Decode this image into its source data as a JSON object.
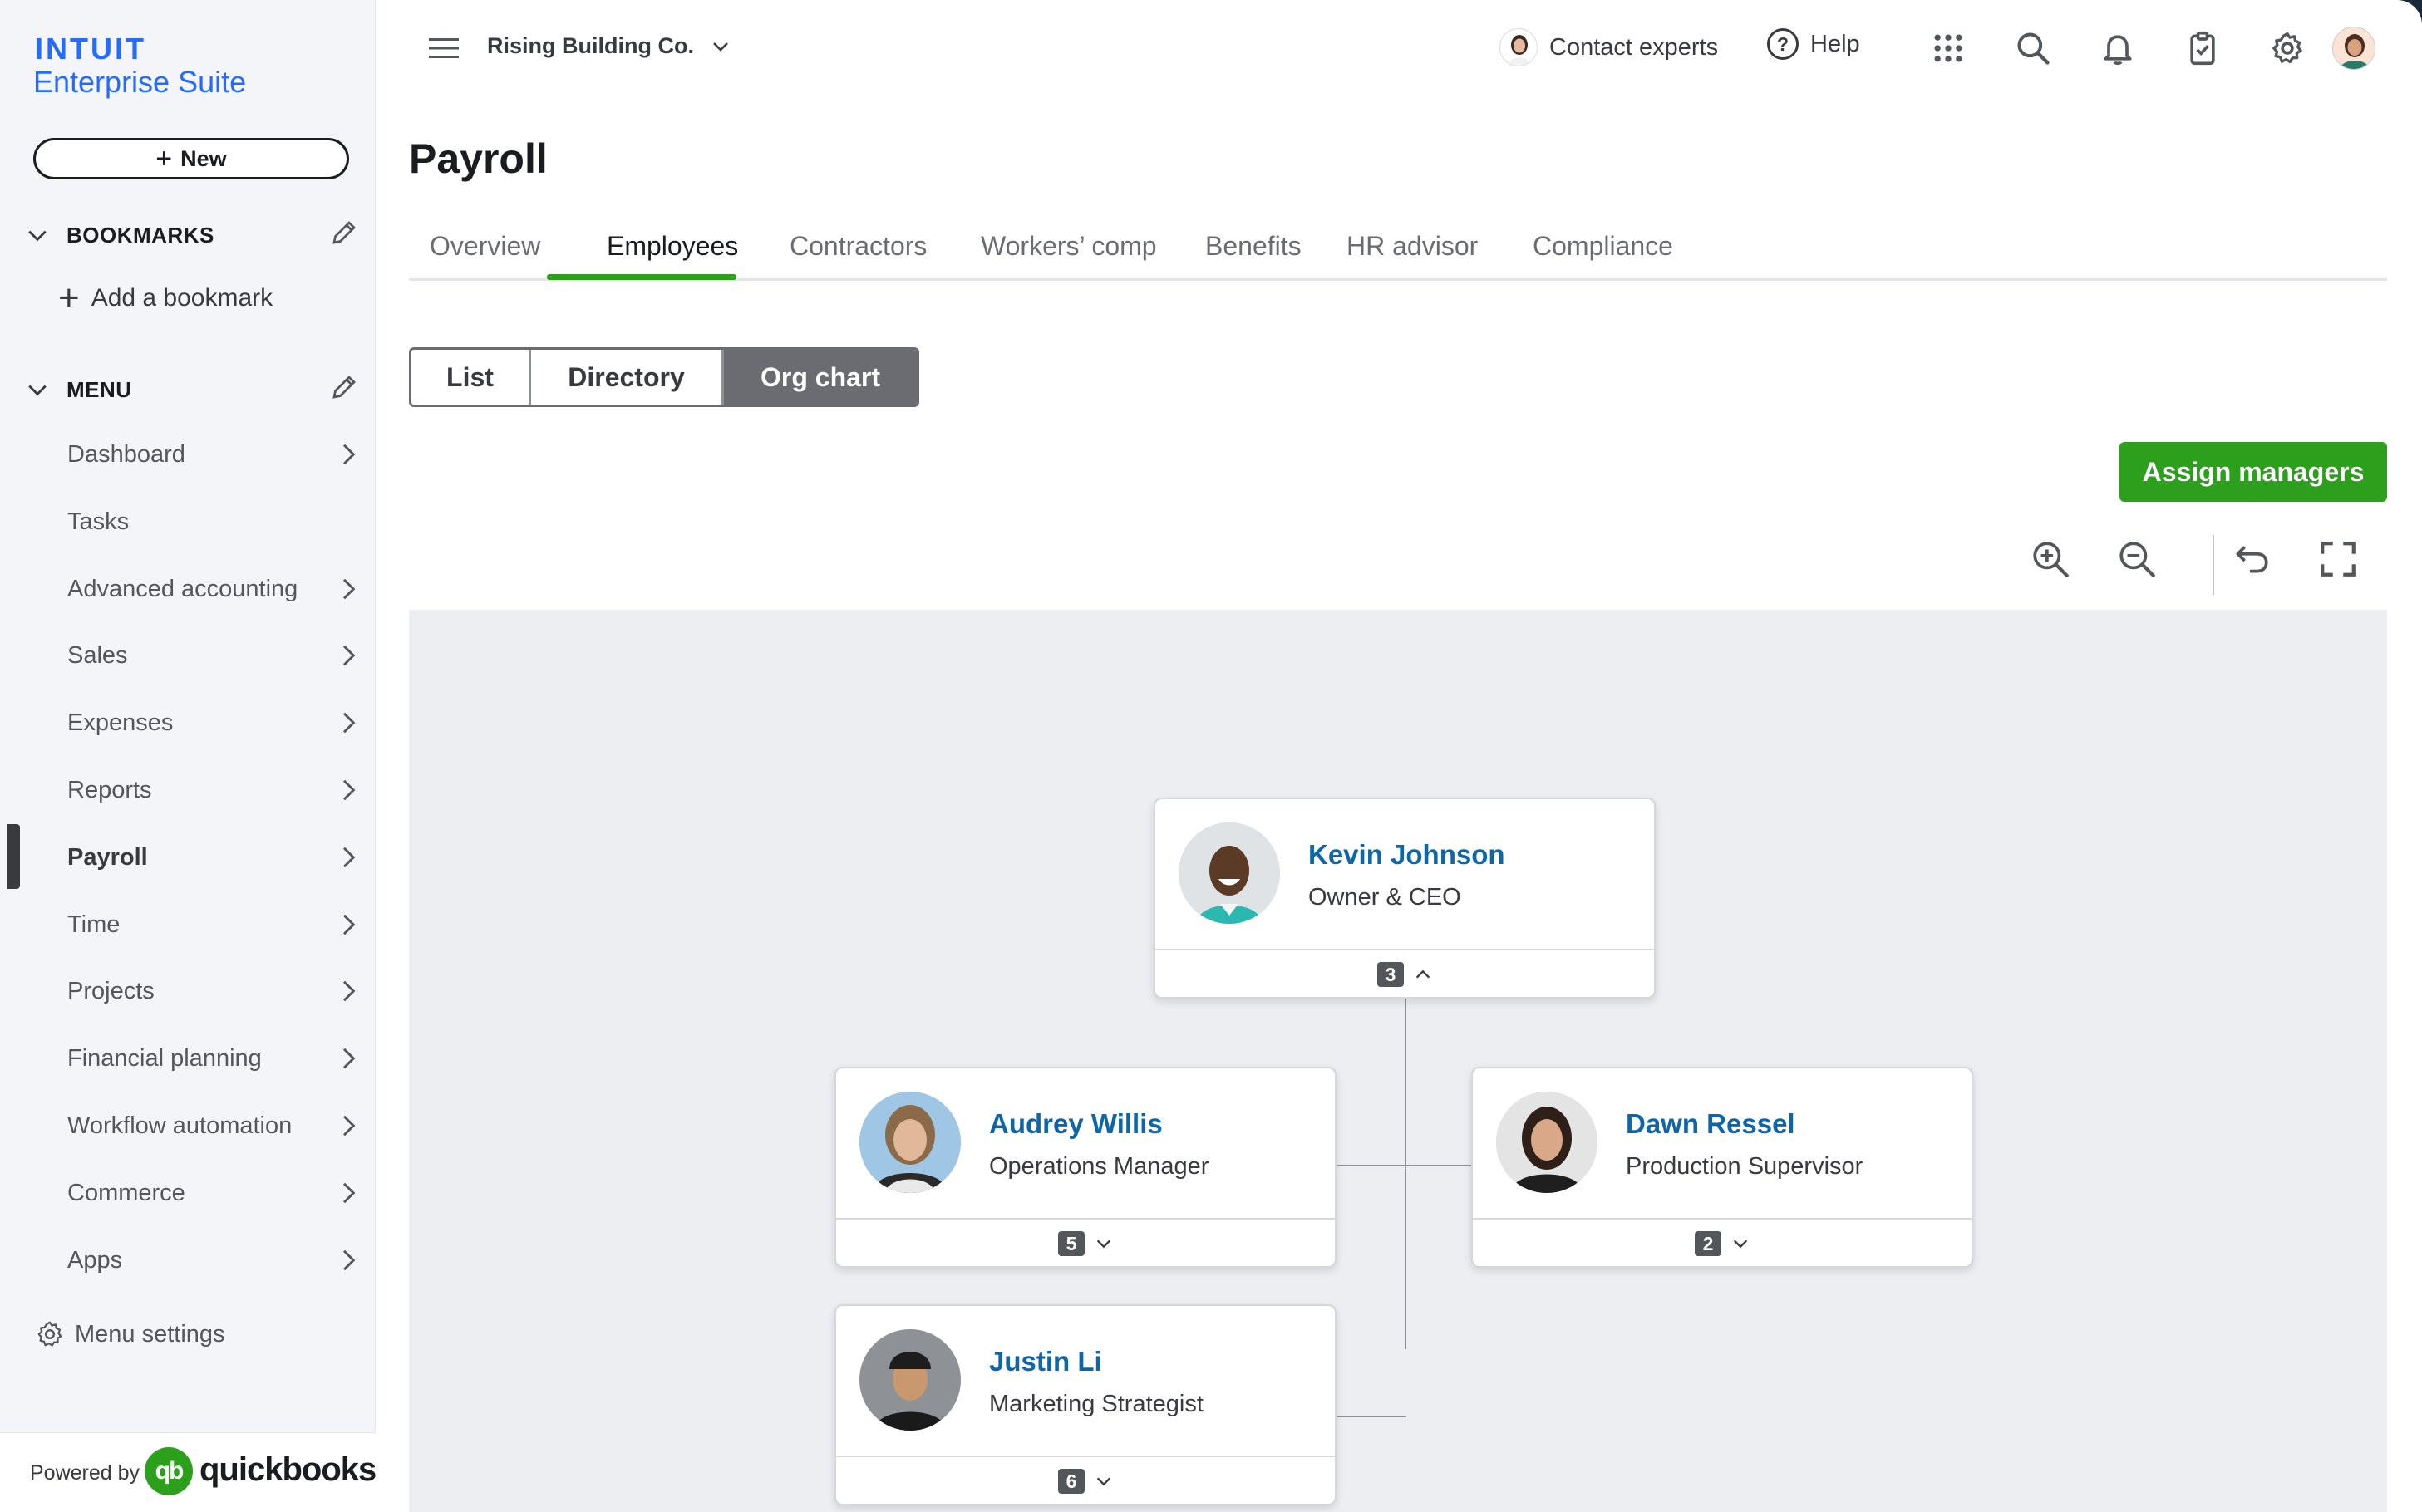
{
  "brand": {
    "logo_text": "INTUIT",
    "product": "Enterprise Suite",
    "accent_color": "#236cff"
  },
  "sidebar": {
    "new_button": "New",
    "bookmarks": {
      "heading": "BOOKMARKS",
      "add_label": "Add a bookmark"
    },
    "menu": {
      "heading": "MENU",
      "items": [
        {
          "label": "Dashboard",
          "arrow": true
        },
        {
          "label": "Tasks",
          "arrow": false
        },
        {
          "label": "Advanced accounting",
          "arrow": true
        },
        {
          "label": "Sales",
          "arrow": true
        },
        {
          "label": "Expenses",
          "arrow": true
        },
        {
          "label": "Reports",
          "arrow": true
        },
        {
          "label": "Payroll",
          "arrow": true,
          "active": true
        },
        {
          "label": "Time",
          "arrow": true
        },
        {
          "label": "Projects",
          "arrow": true
        },
        {
          "label": "Financial planning",
          "arrow": true
        },
        {
          "label": "Workflow automation",
          "arrow": true
        },
        {
          "label": "Commerce",
          "arrow": true
        },
        {
          "label": "Apps",
          "arrow": true
        }
      ]
    },
    "menu_settings": "Menu settings",
    "powered_by": "Powered by",
    "quickbooks": "quickbooks",
    "qb_icon": "qb"
  },
  "topbar": {
    "company": "Rising Building Co.",
    "contact_experts": "Contact experts",
    "help": "Help",
    "help_glyph": "?",
    "icons": [
      "apps-grid-icon",
      "search-icon",
      "bell-icon",
      "clipboard-icon",
      "gear-icon"
    ]
  },
  "page": {
    "title": "Payroll",
    "tabs": [
      {
        "label": "Overview"
      },
      {
        "label": "Employees",
        "active": true
      },
      {
        "label": "Contractors"
      },
      {
        "label": "Workers’ comp"
      },
      {
        "label": "Benefits"
      },
      {
        "label": "HR advisor"
      },
      {
        "label": "Compliance"
      }
    ],
    "views": [
      {
        "label": "List"
      },
      {
        "label": "Directory"
      },
      {
        "label": "Org chart",
        "selected": true
      }
    ],
    "assign_managers": "Assign managers",
    "brand_green": "#2ca01c"
  },
  "org_chart": {
    "root": {
      "name": "Kevin Johnson",
      "role": "Owner & CEO",
      "reports": "3",
      "expanded": true
    },
    "children": [
      {
        "name": "Audrey Willis",
        "role": "Operations Manager",
        "reports": "5"
      },
      {
        "name": "Dawn Ressel",
        "role": "Production Supervisor",
        "reports": "2"
      },
      {
        "name": "Justin Li",
        "role": "Marketing Strategist",
        "reports": "6"
      }
    ]
  }
}
